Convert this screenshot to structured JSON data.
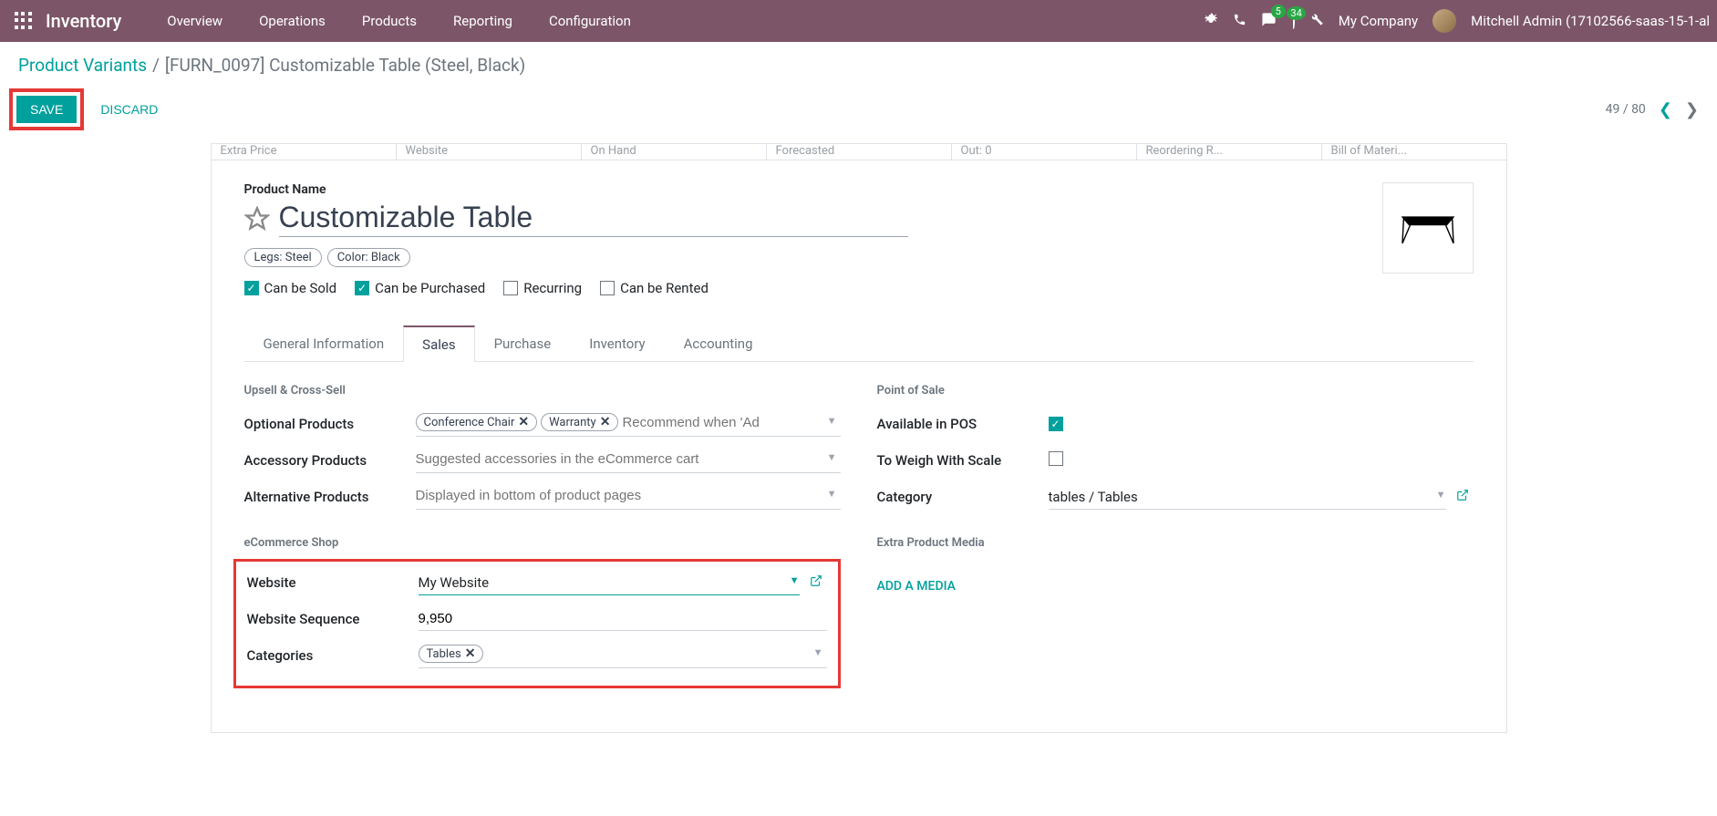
{
  "navbar": {
    "brand": "Inventory",
    "menu": [
      "Overview",
      "Operations",
      "Products",
      "Reporting",
      "Configuration"
    ],
    "badge_messages": "5",
    "badge_activities": "34",
    "company": "My Company",
    "user": "Mitchell Admin (17102566-saas-15-1-al"
  },
  "breadcrumb": {
    "parent": "Product Variants",
    "current": "[FURN_0097] Customizable Table (Steel, Black)"
  },
  "actions": {
    "save": "SAVE",
    "discard": "DISCARD",
    "pager": "49 / 80"
  },
  "stat_buttons": [
    "Extra Price",
    "Website",
    "On Hand",
    "Forecasted",
    "Out: 0",
    "Reordering R...",
    "Bill of Materi..."
  ],
  "product": {
    "name_label": "Product Name",
    "name": "Customizable Table",
    "variant_tags": [
      "Legs: Steel",
      "Color: Black"
    ],
    "checkboxes": {
      "can_be_sold": {
        "label": "Can be Sold",
        "checked": true
      },
      "can_be_purchased": {
        "label": "Can be Purchased",
        "checked": true
      },
      "recurring": {
        "label": "Recurring",
        "checked": false
      },
      "can_be_rented": {
        "label": "Can be Rented",
        "checked": false
      }
    }
  },
  "tabs": [
    "General Information",
    "Sales",
    "Purchase",
    "Inventory",
    "Accounting"
  ],
  "active_tab": "Sales",
  "sales": {
    "upsell_title": "Upsell & Cross-Sell",
    "optional_label": "Optional Products",
    "optional_tags": [
      "Conference Chair",
      "Warranty"
    ],
    "optional_placeholder": "Recommend when 'Ad",
    "accessory_label": "Accessory Products",
    "accessory_placeholder": "Suggested accessories in the eCommerce cart",
    "alternative_label": "Alternative Products",
    "alternative_placeholder": "Displayed in bottom of product pages",
    "ecommerce_title": "eCommerce Shop",
    "website_label": "Website",
    "website_value": "My Website",
    "sequence_label": "Website Sequence",
    "sequence_value": "9,950",
    "categories_label": "Categories",
    "categories_tags": [
      "Tables"
    ],
    "pos_title": "Point of Sale",
    "pos_available_label": "Available in POS",
    "pos_available": true,
    "pos_weigh_label": "To Weigh With Scale",
    "pos_weigh": false,
    "pos_category_label": "Category",
    "pos_category_value": "tables / Tables",
    "media_title": "Extra Product Media",
    "add_media": "ADD A MEDIA"
  }
}
